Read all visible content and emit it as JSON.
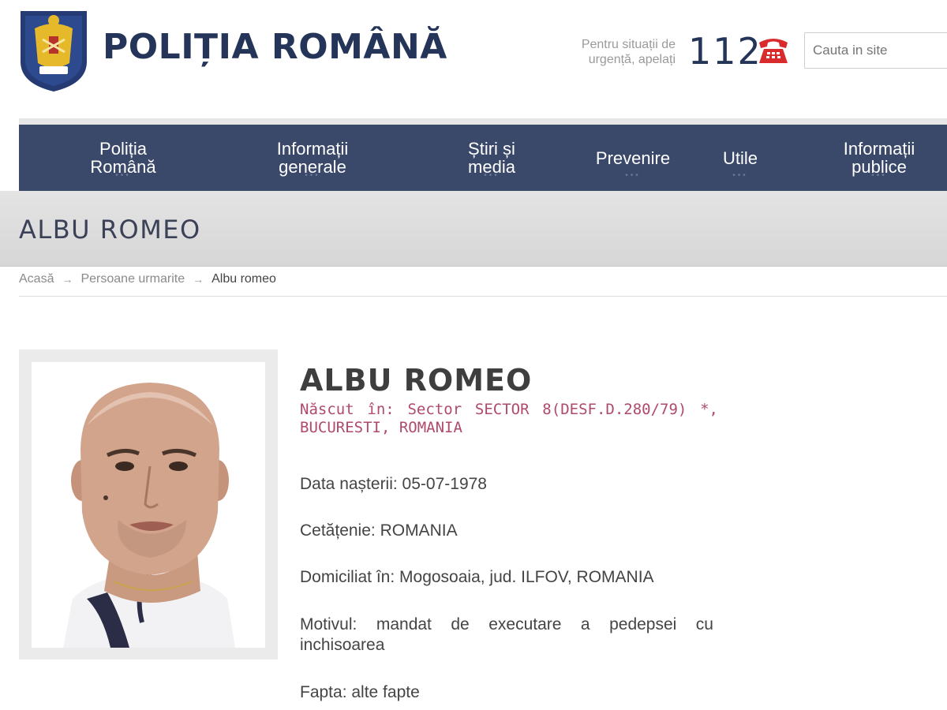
{
  "header": {
    "site_title": "POLIȚIA ROMÂNĂ",
    "emergency_text": "Pentru situații de urgență, apelați",
    "emergency_number": "112",
    "search_placeholder": "Cauta in site",
    "logo_icon": "coat-of-arms-icon",
    "phone_icon": "phone-icon"
  },
  "nav": {
    "items": [
      {
        "label_line1": "Poliția",
        "label_line2": "Română"
      },
      {
        "label_line1": "Informații",
        "label_line2": "generale"
      },
      {
        "label_line1": "Știri și",
        "label_line2": "media"
      },
      {
        "label_line1": "Prevenire",
        "label_line2": ""
      },
      {
        "label_line1": "Utile",
        "label_line2": ""
      },
      {
        "label_line1": "Informații",
        "label_line2": "publice"
      }
    ],
    "dots": "•••"
  },
  "page": {
    "title": "ALBU ROMEO"
  },
  "breadcrumb": {
    "separator": "→",
    "items": [
      "Acasă",
      "Persoane urmarite",
      "Albu romeo"
    ]
  },
  "profile": {
    "name": "ALBU ROMEO",
    "birthplace": "Născut în: Sector SECTOR 8(DESF.D.280/79) *, BUCURESTI, ROMANIA",
    "birth_date": "Data nașterii: 05-07-1978",
    "citizenship": "Cetățenie: ROMANIA",
    "domicile": "Domiciliat în: Mogosoaia, jud. ILFOV, ROMANIA",
    "motive": "Motivul: mandat de executare a pedepsei cu inchisoarea",
    "deed": "Fapta: alte fapte"
  },
  "colors": {
    "brand_navy": "#253559",
    "nav_bg": "#3a4869",
    "birthplace_text": "#b04a6a",
    "phone_red": "#d92b2b"
  }
}
